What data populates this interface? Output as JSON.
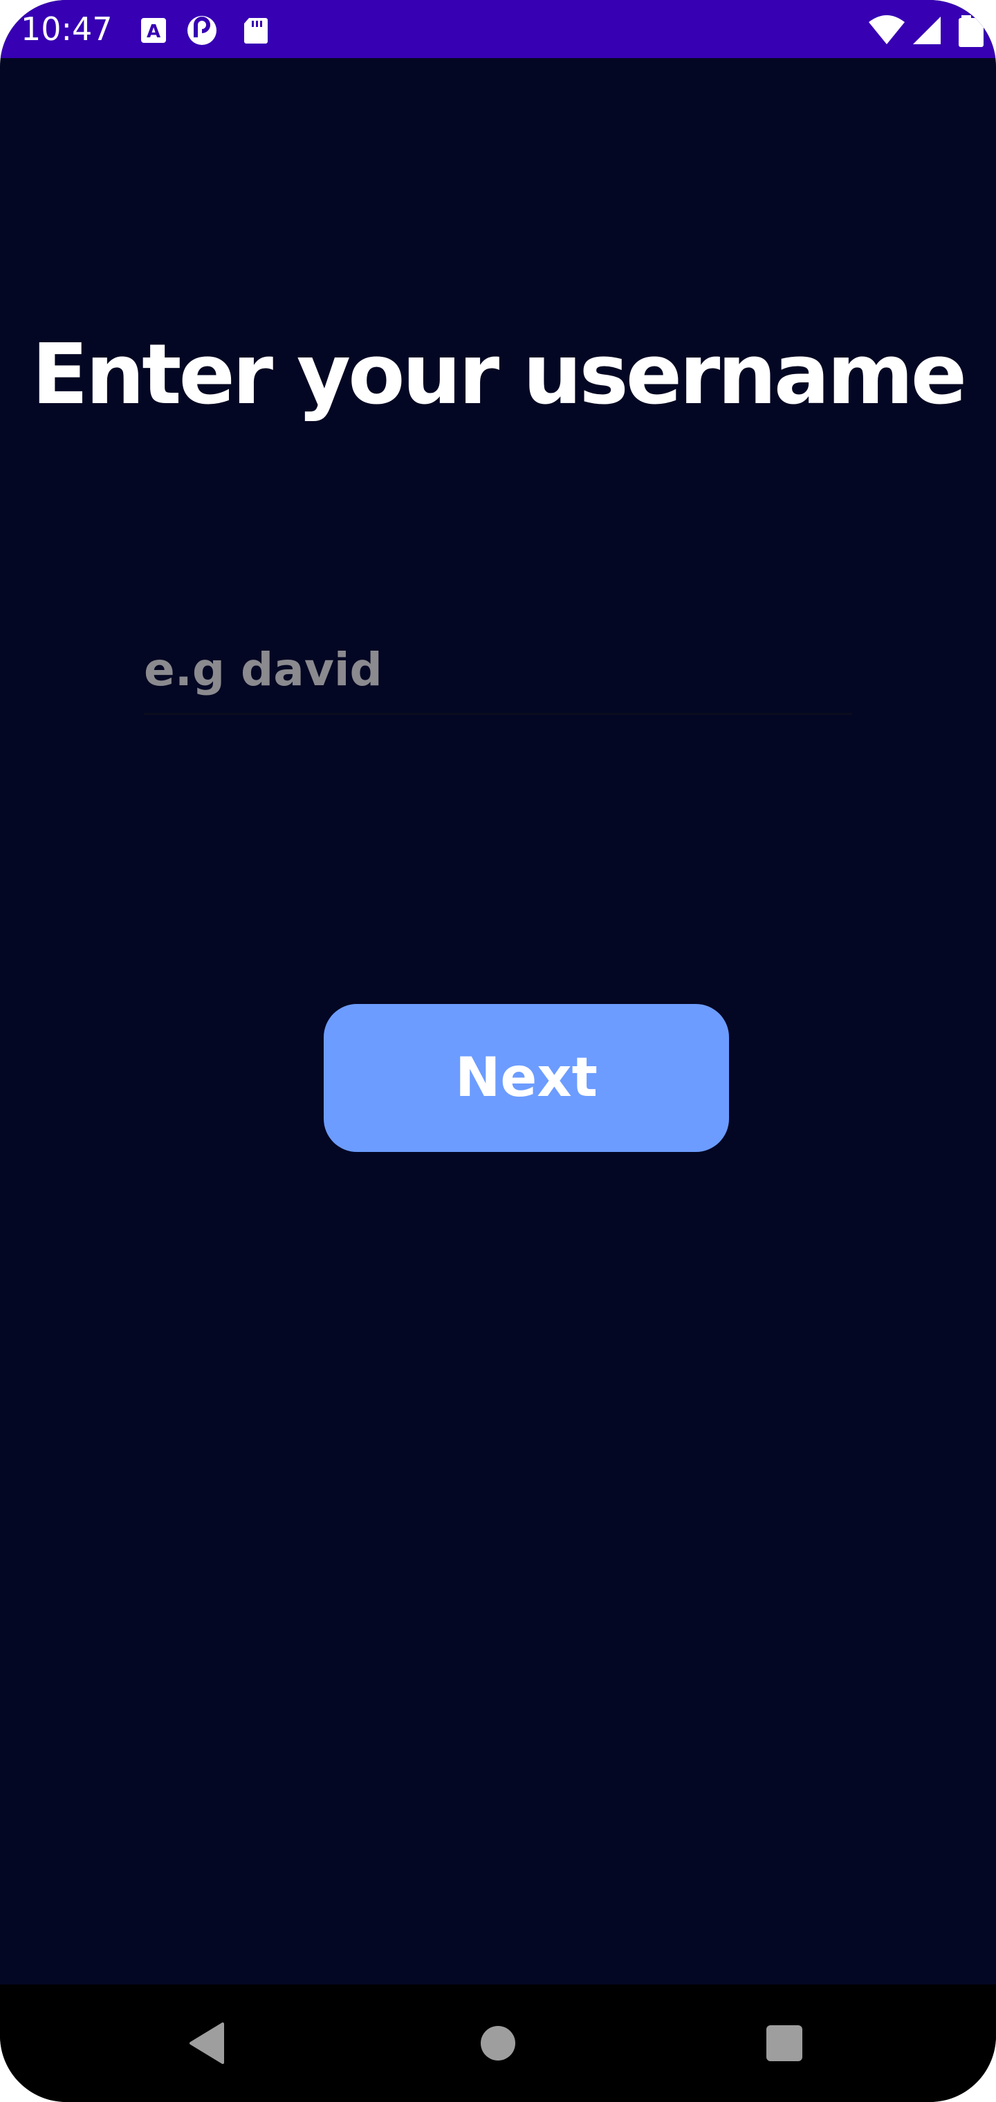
{
  "status_bar": {
    "time": "10:47",
    "background_color": "#3700b3",
    "left_icons": [
      "text-a-notification-icon",
      "pocket-casts-icon",
      "sd-card-icon"
    ],
    "right_icons": [
      "wifi-icon",
      "cell-signal-icon",
      "battery-icon"
    ]
  },
  "screen": {
    "background_color": "#040723",
    "title": "Enter your username",
    "username_input": {
      "value": "",
      "placeholder": "e.g david"
    },
    "next_button": {
      "label": "Next",
      "color": "#6c9cff"
    }
  },
  "nav_bar": {
    "buttons": [
      "back-icon",
      "home-icon",
      "recents-icon"
    ]
  }
}
